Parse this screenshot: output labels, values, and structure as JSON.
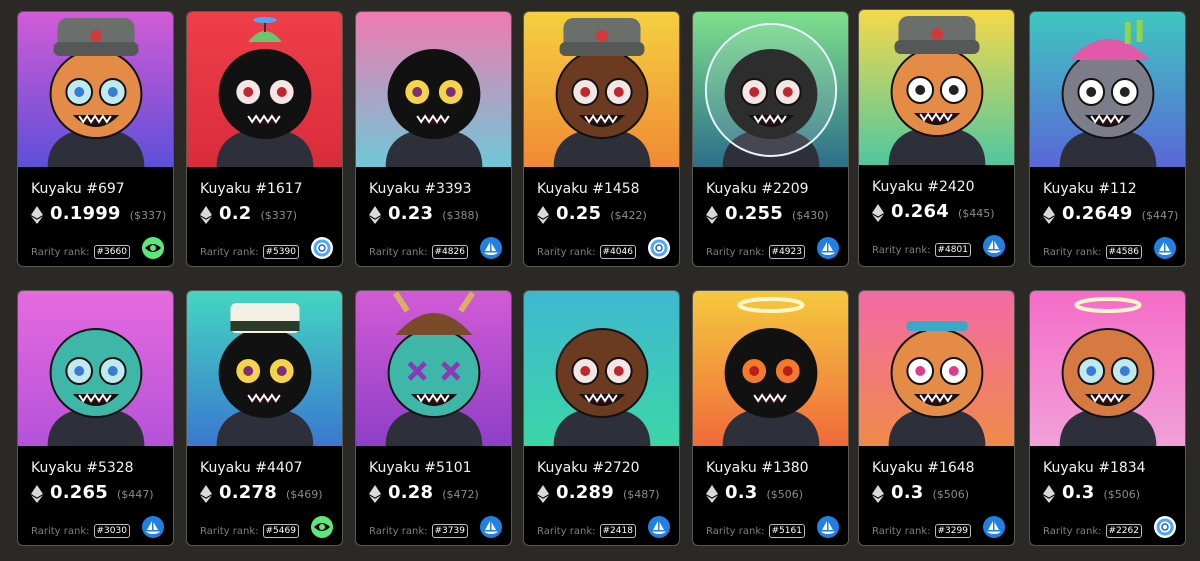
{
  "colors": {
    "page_bg": "#2a2925",
    "card_bg": "#000000",
    "card_border": "#5a5750",
    "opensea_blue": "#2081e2",
    "looksrare_green": "#5ee87c",
    "x2y2_ring": "#4aa8ff"
  },
  "labels": {
    "rarity_prefix": "Rarity rank:"
  },
  "cards": [
    {
      "name": "Kuyaku #697",
      "price": "0.1999",
      "usd": "($337)",
      "rank": "#3660",
      "marketplace": "looksrare-eye-icon",
      "bg": [
        "#d25bd6",
        "#5d4fd8"
      ],
      "skin": "#e38b47",
      "hat": "ushanka",
      "eyes": "spiral"
    },
    {
      "name": "Kuyaku #1617",
      "price": "0.2",
      "usd": "($337)",
      "rank": "#5390",
      "marketplace": "x2y2-ring-icon",
      "bg": [
        "#f03e4a",
        "#d92c3a"
      ],
      "skin": "#111111",
      "hat": "propeller",
      "eyes": "red"
    },
    {
      "name": "Kuyaku #3393",
      "price": "0.23",
      "usd": "($388)",
      "rank": "#4826",
      "marketplace": "opensea-ship-icon",
      "bg": [
        "#f07ab0",
        "#6fc8d8"
      ],
      "skin": "#111111",
      "hat": "none",
      "eyes": "yellow"
    },
    {
      "name": "Kuyaku #1458",
      "price": "0.25",
      "usd": "($422)",
      "rank": "#4046",
      "marketplace": "x2y2-ring-icon",
      "bg": [
        "#f5d03f",
        "#f08a34"
      ],
      "skin": "#6b3a21",
      "hat": "ushanka",
      "eyes": "red"
    },
    {
      "name": "Kuyaku #2209",
      "price": "0.255",
      "usd": "($430)",
      "rank": "#4923",
      "marketplace": "opensea-ship-icon",
      "bg": [
        "#7ee08c",
        "#2d6e8a"
      ],
      "skin": "#111111",
      "hat": "helmet",
      "eyes": "red"
    },
    {
      "name": "Kuyaku #2420",
      "price": "0.264",
      "usd": "($445)",
      "rank": "#4801",
      "marketplace": "opensea-ship-icon",
      "bg": [
        "#f5d94a",
        "#4fc7a0"
      ],
      "skin": "#e38b47",
      "hat": "ushanka",
      "eyes": "white"
    },
    {
      "name": "Kuyaku #112",
      "price": "0.2649",
      "usd": "($447)",
      "rank": "#4586",
      "marketplace": "opensea-ship-icon",
      "bg": [
        "#3ec7c0",
        "#5a67d8"
      ],
      "skin": "#7d7d8a",
      "hat": "cap",
      "eyes": "white"
    },
    {
      "name": "Kuyaku #5328",
      "price": "0.265",
      "usd": "($447)",
      "rank": "#3030",
      "marketplace": "opensea-ship-icon",
      "bg": [
        "#e66adf",
        "#b552d9"
      ],
      "skin": "#3fb7a8",
      "hat": "none",
      "eyes": "spiral"
    },
    {
      "name": "Kuyaku #4407",
      "price": "0.278",
      "usd": "($469)",
      "rank": "#5469",
      "marketplace": "looksrare-eye-icon",
      "bg": [
        "#44d6c2",
        "#3a78d0"
      ],
      "skin": "#111111",
      "hat": "sushi",
      "eyes": "yellow"
    },
    {
      "name": "Kuyaku #5101",
      "price": "0.28",
      "usd": "($472)",
      "rank": "#3739",
      "marketplace": "opensea-ship-icon",
      "bg": [
        "#d25bd6",
        "#8e3fc7"
      ],
      "skin": "#3fb7a8",
      "hat": "samurai",
      "eyes": "cross"
    },
    {
      "name": "Kuyaku #2720",
      "price": "0.289",
      "usd": "($487)",
      "rank": "#2418",
      "marketplace": "opensea-ship-icon",
      "bg": [
        "#3fb8d0",
        "#3bd6a8"
      ],
      "skin": "#6b3a21",
      "hat": "none",
      "eyes": "red"
    },
    {
      "name": "Kuyaku #1380",
      "price": "0.3",
      "usd": "($506)",
      "rank": "#5161",
      "marketplace": "opensea-ship-icon",
      "bg": [
        "#f5c93e",
        "#f06a3a"
      ],
      "skin": "#111111",
      "hat": "halo",
      "eyes": "fire"
    },
    {
      "name": "Kuyaku #1648",
      "price": "0.3",
      "usd": "($506)",
      "rank": "#3299",
      "marketplace": "opensea-ship-icon",
      "bg": [
        "#f36aa6",
        "#f08a4a"
      ],
      "skin": "#e38b47",
      "hat": "band",
      "eyes": "star"
    },
    {
      "name": "Kuyaku #1834",
      "price": "0.3",
      "usd": "($506)",
      "rank": "#2262",
      "marketplace": "x2y2-ring-icon",
      "bg": [
        "#f56cc8",
        "#f2a0d8"
      ],
      "skin": "#d77a42",
      "hat": "halo",
      "eyes": "spiral"
    }
  ]
}
